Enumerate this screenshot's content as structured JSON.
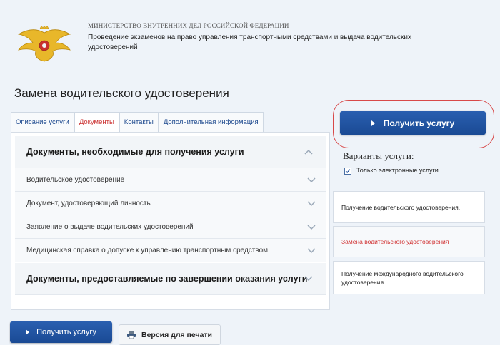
{
  "header": {
    "ministry": "МИНИСТЕРСТВО ВНУТРЕННИХ ДЕЛ РОССИЙСКОЙ ФЕДЕРАЦИИ",
    "description": "Проведение экзаменов на право управления транспортными средствами и выдача водительских удостоверений",
    "emblem_icon": "double-headed-eagle-emblem"
  },
  "page_title": "Замена водительского удостоверения",
  "tabs": [
    {
      "label": "Описание услуги",
      "active": false
    },
    {
      "label": "Документы",
      "active": true
    },
    {
      "label": "Контакты",
      "active": false
    },
    {
      "label": "Дополнительная информация",
      "active": false
    }
  ],
  "documents": {
    "required_section": "Документы, необходимые для получения услуги",
    "items": [
      "Водительское удостоверение",
      "Документ, удостоверяющий личность",
      "Заявление о выдаче водительских удостоверений",
      "Медицинская справка о допуске к управлению транспортным средством"
    ],
    "result_section": "Документы, предоставляемые по завершении оказания услуги"
  },
  "sidebar": {
    "get_service": "Получить услугу",
    "variants_title": "Варианты услуги:",
    "only_electronic": "Только электронные услуги",
    "only_electronic_checked": true,
    "variants": [
      {
        "label": "Получение водительского удостоверения.",
        "active": false
      },
      {
        "label": "Замена водительского удостоверения",
        "active": true
      },
      {
        "label": "Получение международного водительского удостоверения",
        "active": false
      }
    ]
  },
  "footer": {
    "get_service": "Получить услугу",
    "print_version": "Версия для печати"
  },
  "colors": {
    "primary_button": "#1f4f9c",
    "active_text": "#d03030",
    "link": "#1e4a8f",
    "highlight": "#d84848"
  }
}
